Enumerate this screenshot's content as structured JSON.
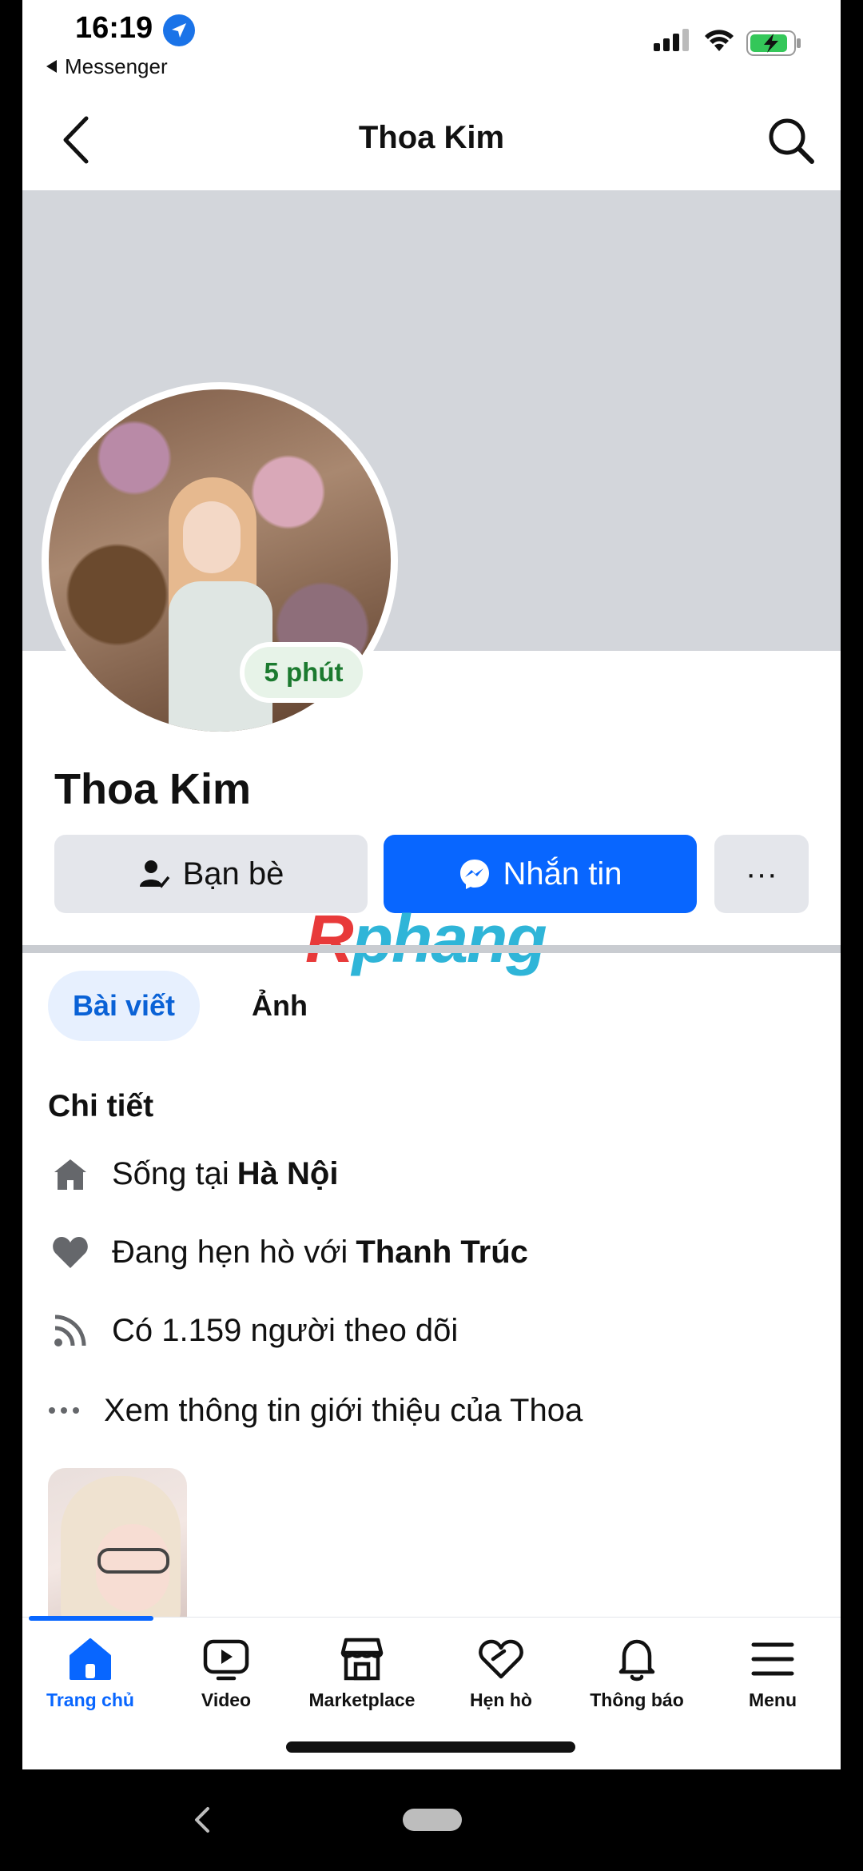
{
  "status_bar": {
    "time": "16:19",
    "back_app": "Messenger"
  },
  "header": {
    "title": "Thoa Kim"
  },
  "profile": {
    "name": "Thoa Kim",
    "active_badge": "5 phút"
  },
  "actions": {
    "friends_label": "Bạn bè",
    "message_label": "Nhắn tin",
    "more_label": "···"
  },
  "watermark": {
    "r": "R",
    "rest": "phang"
  },
  "tabs": [
    {
      "label": "Bài viết",
      "active": true
    },
    {
      "label": "Ảnh",
      "active": false
    }
  ],
  "details": {
    "title": "Chi tiết",
    "lives_prefix": "Sống tại",
    "lives_value": "Hà Nội",
    "dating_prefix": "Đang hẹn hò với",
    "dating_value": "Thanh Trúc",
    "followers": "Có 1.159 người theo dõi",
    "see_more": "Xem thông tin giới thiệu của Thoa"
  },
  "bottom_nav": [
    {
      "label": "Trang chủ",
      "icon": "home-icon",
      "active": true
    },
    {
      "label": "Video",
      "icon": "video-icon",
      "active": false
    },
    {
      "label": "Marketplace",
      "icon": "marketplace-icon",
      "active": false
    },
    {
      "label": "Hẹn hò",
      "icon": "dating-icon",
      "active": false
    },
    {
      "label": "Thông báo",
      "icon": "bell-icon",
      "active": false
    },
    {
      "label": "Menu",
      "icon": "menu-icon",
      "active": false
    }
  ],
  "colors": {
    "accent": "#0866ff",
    "button_gray": "#e4e6eb",
    "cover_gray": "#d3d6db",
    "online_green": "#1b7a2f"
  }
}
